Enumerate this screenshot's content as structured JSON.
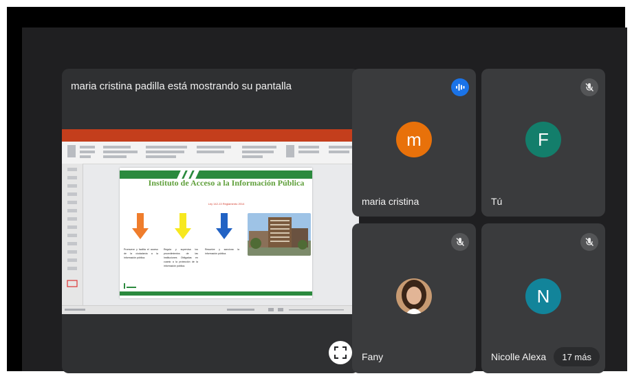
{
  "presentation": {
    "title": "maria cristina padilla está mostrando su pantalla",
    "slide": {
      "title": "Instituto de Acceso a la Información Pública",
      "subtitle": "Ley 142-13 Reglamento 2014",
      "columns": [
        {
          "text": "Promueve y facilita el acceso de la ciudadanía a la información pública.",
          "arrow_color": "#ef7d2c"
        },
        {
          "text": "Regula y supervisa los procedimientos de las Instituciones Obligadas en cuanto a la protección de la información pública.",
          "arrow_color": "#f7e81f"
        },
        {
          "text": "Resuelve y sanciona la información pública.",
          "arrow_color": "#2162c4"
        }
      ]
    }
  },
  "participants": [
    {
      "name": "maria cristina",
      "initial": "m",
      "avatar_color": "#e8710a",
      "mic": "speaking"
    },
    {
      "name": "Tú",
      "initial": "F",
      "avatar_color": "#137e6b",
      "mic": "muted"
    },
    {
      "name": "Fany",
      "initial": "",
      "avatar_color": "#b07850",
      "mic": "muted"
    },
    {
      "name": "Nicolle Alexa",
      "initial": "N",
      "avatar_color": "#12849a",
      "mic": "muted"
    }
  ],
  "more_count": "17 más",
  "icons": {
    "speaking": "audio-wave-icon",
    "muted": "mic-off-icon",
    "fullscreen": "fullscreen-icon"
  }
}
